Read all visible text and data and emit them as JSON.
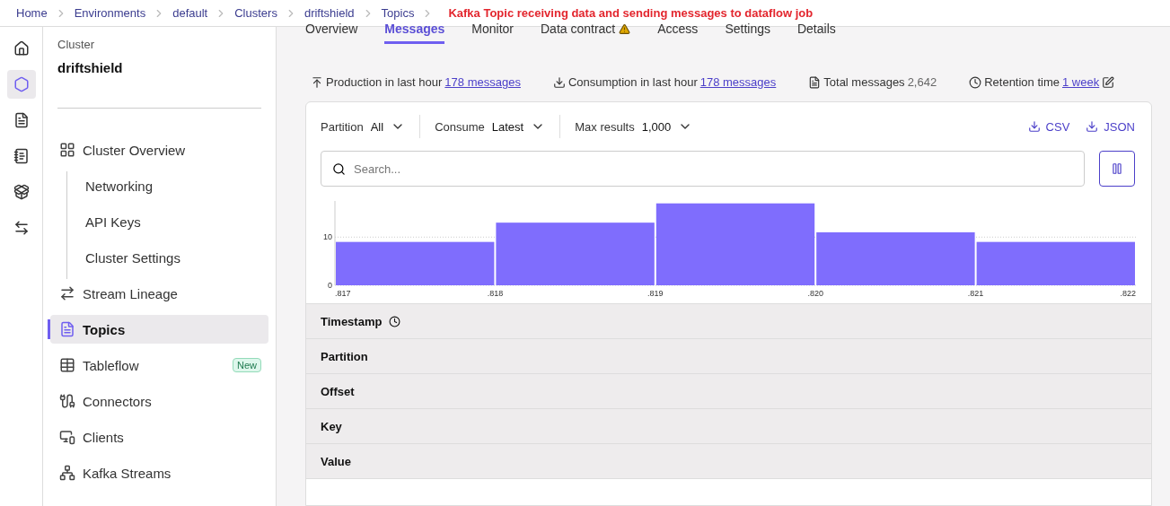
{
  "breadcrumbs": [
    {
      "label": "Home"
    },
    {
      "label": "Environments"
    },
    {
      "label": "default"
    },
    {
      "label": "Clusters"
    },
    {
      "label": "driftshield"
    },
    {
      "label": "Topics"
    }
  ],
  "annotation": "Kafka Topic receiving data and sending messages to dataflow job",
  "rail": [
    {
      "selected": false
    },
    {
      "selected": true
    },
    {
      "selected": false
    },
    {
      "selected": false
    },
    {
      "selected": false
    },
    {
      "selected": false
    }
  ],
  "sidebar": {
    "caption": "Cluster",
    "title": "driftshield",
    "items": [
      {
        "label": "Cluster Overview",
        "selected": false,
        "children": [
          {
            "label": "Networking",
            "selected": false
          },
          {
            "label": "API Keys",
            "selected": false
          },
          {
            "label": "Cluster Settings",
            "selected": false
          }
        ]
      },
      {
        "label": "Stream Lineage",
        "selected": false
      },
      {
        "label": "Topics",
        "selected": true
      },
      {
        "label": "Tableflow",
        "selected": false,
        "badge": "New"
      },
      {
        "label": "Connectors",
        "selected": false
      },
      {
        "label": "Clients",
        "selected": false
      },
      {
        "label": "Kafka Streams",
        "selected": false
      }
    ]
  },
  "tabs": [
    {
      "label": "Overview",
      "selected": false
    },
    {
      "label": "Messages",
      "selected": true
    },
    {
      "label": "Monitor",
      "selected": false
    },
    {
      "label": "Data contract",
      "selected": false,
      "warning": true
    },
    {
      "label": "Access",
      "selected": false
    },
    {
      "label": "Settings",
      "selected": false
    },
    {
      "label": "Details",
      "selected": false
    }
  ],
  "stats": [
    {
      "label": "Production in last hour",
      "value": "178 messages",
      "kind": "link"
    },
    {
      "label": "Consumption in last hour",
      "value": "178 messages",
      "kind": "link"
    },
    {
      "label": "Total messages",
      "value": "2,642",
      "kind": "value"
    },
    {
      "label": "Retention time",
      "value": "1 week",
      "kind": "link",
      "editable": true
    }
  ],
  "filters": [
    {
      "label": "Partition",
      "value": "All"
    },
    {
      "label": "Consume",
      "value": "Latest"
    },
    {
      "label": "Max results",
      "value": "1,000"
    }
  ],
  "exports": [
    "CSV",
    "JSON"
  ],
  "search": {
    "placeholder": "Search..."
  },
  "chart_data": {
    "type": "bar",
    "x": [
      0.8175,
      0.8185,
      0.8195,
      0.8205,
      0.8215
    ],
    "series": [
      {
        "color": "#7f6dfd",
        "values": [
          9,
          13,
          17,
          11,
          9
        ]
      }
    ],
    "xlim": [
      0.817,
      0.822
    ],
    "ylim": [
      0,
      17.5
    ],
    "xticks": [
      {
        "value": 0.817,
        "label": ".817"
      },
      {
        "value": 0.818,
        "label": ".818"
      },
      {
        "value": 0.819,
        "label": ".819"
      },
      {
        "value": 0.82,
        "label": ".820"
      },
      {
        "value": 0.821,
        "label": ".821"
      },
      {
        "value": 0.822,
        "label": ".822"
      }
    ],
    "yticks": [
      0,
      10
    ]
  },
  "columns": [
    {
      "label": "Timestamp",
      "icon": true
    },
    {
      "label": "Partition",
      "icon": false
    },
    {
      "label": "Offset",
      "icon": false
    },
    {
      "label": "Key",
      "icon": false
    },
    {
      "label": "Value",
      "icon": false
    }
  ]
}
